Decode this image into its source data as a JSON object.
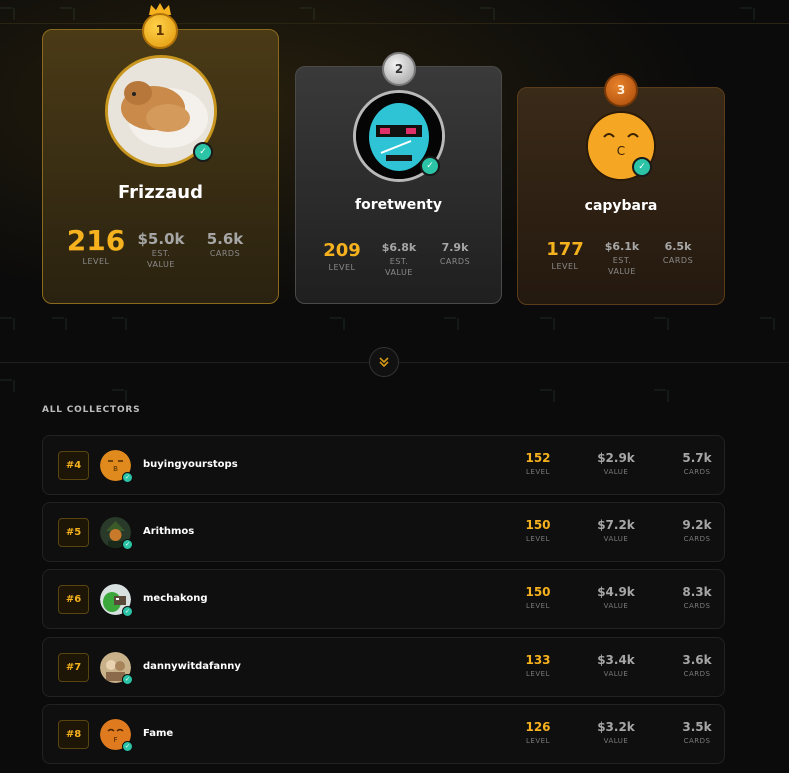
{
  "podium": [
    {
      "rank": "1",
      "name": "Frizzaud",
      "level": "216",
      "level_label": "LEVEL",
      "value": "$5.0k",
      "value_label_1": "EST.",
      "value_label_2": "VALUE",
      "cards": "5.6k",
      "cards_label": "CARDS"
    },
    {
      "rank": "2",
      "name": "foretwenty",
      "level": "209",
      "level_label": "LEVEL",
      "value": "$6.8k",
      "value_label_1": "EST.",
      "value_label_2": "VALUE",
      "cards": "7.9k",
      "cards_label": "CARDS"
    },
    {
      "rank": "3",
      "name": "capybara",
      "level": "177",
      "level_label": "LEVEL",
      "value": "$6.1k",
      "value_label_1": "EST.",
      "value_label_2": "VALUE",
      "cards": "6.5k",
      "cards_label": "CARDS"
    }
  ],
  "section_title": "ALL COLLECTORS",
  "collectors": [
    {
      "rank": "#4",
      "name": "buyingyourstops",
      "level": "152",
      "level_label": "LEVEL",
      "value": "$2.9k",
      "value_label": "VALUE",
      "cards": "5.7k",
      "cards_label": "CARDS",
      "avatar": "orange-b"
    },
    {
      "rank": "#5",
      "name": "Arithmos",
      "level": "150",
      "level_label": "LEVEL",
      "value": "$7.2k",
      "value_label": "VALUE",
      "cards": "9.2k",
      "cards_label": "CARDS",
      "avatar": "wizard"
    },
    {
      "rank": "#6",
      "name": "mechakong",
      "level": "150",
      "level_label": "LEVEL",
      "value": "$4.9k",
      "value_label": "VALUE",
      "cards": "8.3k",
      "cards_label": "CARDS",
      "avatar": "green-character"
    },
    {
      "rank": "#7",
      "name": "dannywitdafanny",
      "level": "133",
      "level_label": "LEVEL",
      "value": "$3.4k",
      "value_label": "VALUE",
      "cards": "3.6k",
      "cards_label": "CARDS",
      "avatar": "photo"
    },
    {
      "rank": "#8",
      "name": "Fame",
      "level": "126",
      "level_label": "LEVEL",
      "value": "$3.2k",
      "value_label": "VALUE",
      "cards": "3.5k",
      "cards_label": "CARDS",
      "avatar": "orange-f"
    }
  ],
  "icons": {
    "crown": "crown-icon",
    "verified": "verified-check-icon",
    "expand": "chevron-double-down-icon"
  },
  "colors": {
    "gold": "#f5b11e",
    "verified": "#2bc4a6",
    "background": "#0b0b0b"
  }
}
